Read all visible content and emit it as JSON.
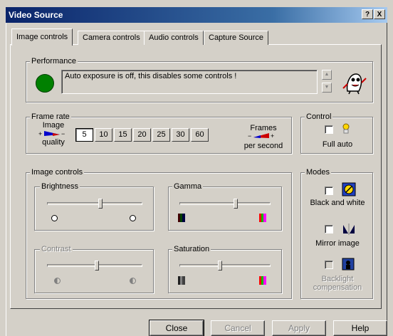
{
  "window": {
    "title": "Video Source",
    "help_glyph": "?",
    "close_glyph": "X"
  },
  "tabs": [
    {
      "label": "Image controls"
    },
    {
      "label": "Camera controls"
    },
    {
      "label": "Audio controls"
    },
    {
      "label": "Capture Source"
    }
  ],
  "performance": {
    "legend": "Performance",
    "status_color": "#008000",
    "message": "Auto exposure is off, this disables some controls !"
  },
  "frame_rate": {
    "legend": "Frame rate",
    "left_label_top": "Image",
    "left_label_bottom": "quality",
    "right_label_top": "Frames",
    "right_label_bottom": "per second",
    "rates": [
      "5",
      "10",
      "15",
      "20",
      "25",
      "30",
      "60"
    ],
    "selected": "5"
  },
  "control": {
    "legend": "Control",
    "full_auto_label": "Full auto"
  },
  "image_controls": {
    "legend": "Image controls",
    "brightness": {
      "label": "Brightness",
      "value": 0.56
    },
    "gamma": {
      "label": "Gamma",
      "value": 0.62
    },
    "contrast": {
      "label": "Contrast",
      "value": 0.52
    },
    "saturation": {
      "label": "Saturation",
      "value": 0.44
    }
  },
  "modes": {
    "legend": "Modes",
    "black_white_label": "Black and white",
    "mirror_label": "Mirror image",
    "backlight_label_1": "Backlight",
    "backlight_label_2": "compensation"
  },
  "buttons": {
    "close": "Close",
    "cancel": "Cancel",
    "apply": "Apply",
    "help": "Help"
  },
  "colors": {
    "title_bar": "#0a246a",
    "face": "#d4d0c8"
  }
}
